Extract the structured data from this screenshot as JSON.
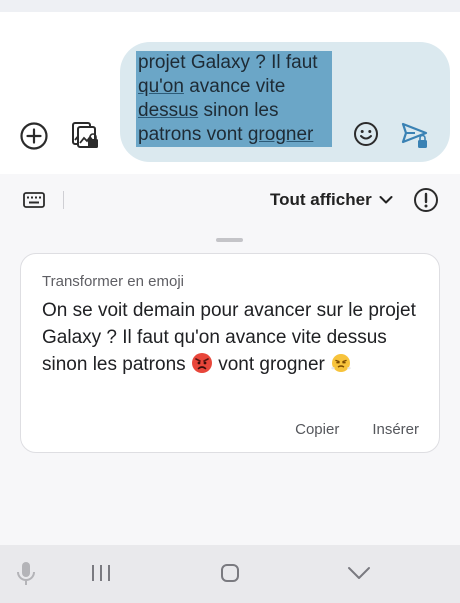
{
  "compose": {
    "message_lines": [
      "projet Galaxy ? Il faut",
      "qu'on avance vite",
      "dessus sinon les",
      "patrons vont grogner"
    ]
  },
  "toolbar": {
    "show_all_label": "Tout afficher"
  },
  "suggestion_card": {
    "title": "Transformer en emoji",
    "body": {
      "part1": "On se voit demain pour avancer sur le projet Galaxy ? Il faut qu'on avance vite dessus sinon les  patrons ",
      "part2": " vont grogner "
    },
    "copy_label": "Copier",
    "insert_label": "Insérer"
  },
  "icons": {
    "add": "add-circle-icon",
    "gallery": "gallery-lock-icon",
    "emoji": "smiley-icon",
    "send": "send-lock-icon",
    "keyboard": "keyboard-icon",
    "dropdown": "chevron-down-icon",
    "info": "info-icon",
    "mic": "microphone-icon",
    "recents": "recents-icon",
    "home": "home-icon",
    "back": "hide-keyboard-icon",
    "angry_emoji": "angry-face-emoji",
    "steam_emoji": "face-with-steam-emoji"
  },
  "colors": {
    "bubble": "#dbe9ef",
    "selection": "#6ba6c7",
    "send": "#3a82b4"
  }
}
